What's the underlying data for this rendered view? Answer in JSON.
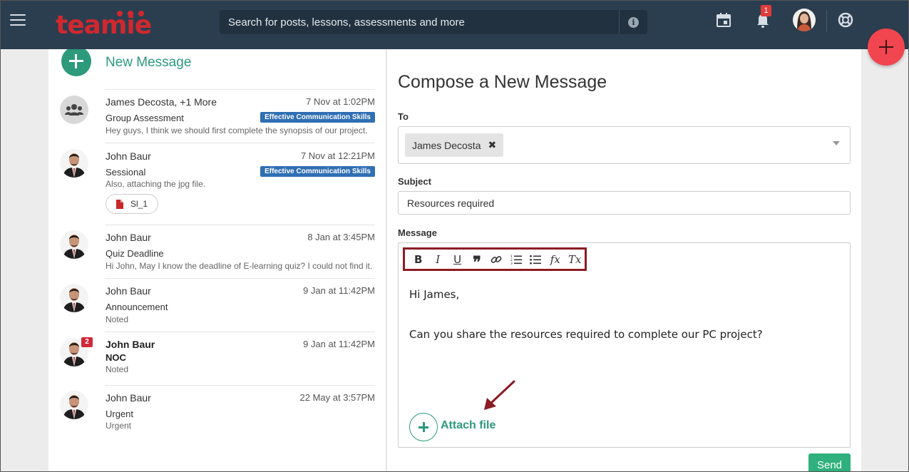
{
  "header": {
    "logo_text": "teamie",
    "search_placeholder": "Search for posts, lessons, assessments and more",
    "info_symbol": "i",
    "notifications_count": "1",
    "bar_color": "#2b3e50",
    "logo_color": "#d0282e"
  },
  "left_panel": {
    "new_message_label": "New Message",
    "threads": [
      {
        "name": "James Decosta, +1 More",
        "time": "7 Nov at 1:02PM",
        "subject": "Group Assessment",
        "tag": "Effective Communication Skills",
        "preview": "Hey guys, I think we should first complete the synopsis of our project.",
        "avatar": "group-icon"
      },
      {
        "name": "John Baur",
        "time": "7 Nov at 12:21PM",
        "subject": "Sessional",
        "tag": "Effective Communication Skills",
        "preview": "Also, attaching the jpg file.",
        "attachment": "Sl_1",
        "avatar": "user-photo"
      },
      {
        "name": "John Baur",
        "time": "8 Jan at 3:45PM",
        "subject": "Quiz Deadline",
        "preview": "Hi John, May I know the deadline of E-learning quiz? I could not find it.",
        "avatar": "user-photo"
      },
      {
        "name": "John Baur",
        "time": "9 Jan at 11:42PM",
        "subject": "Announcement",
        "preview": "Noted",
        "avatar": "user-photo"
      },
      {
        "name": "John Baur",
        "time": "9 Jan at 11:42PM",
        "subject": "NOC",
        "preview": "Noted",
        "unread": "2",
        "avatar": "user-photo"
      },
      {
        "name": "John Baur",
        "time": "22 May at 3:57PM",
        "subject": "Urgent",
        "preview": "Urgent",
        "avatar": "user-photo"
      }
    ]
  },
  "compose": {
    "title": "Compose a New Message",
    "to_label": "To",
    "recipient": "James Decosta",
    "remove_symbol": "✖",
    "subject_label": "Subject",
    "subject_value": "Resources required",
    "message_label": "Message",
    "toolbar": {
      "bold": "B",
      "italic": "I",
      "underline": "U",
      "quote": "❞",
      "formula": "fx",
      "clear": "Tx"
    },
    "body_lines": [
      "Hi James,",
      "",
      "Can you share the resources required to complete our PC project?"
    ],
    "attach_label": "Attach file",
    "send_label": "Send",
    "accent_color": "#2c9a7b",
    "highlight_color": "#8b1c24"
  }
}
